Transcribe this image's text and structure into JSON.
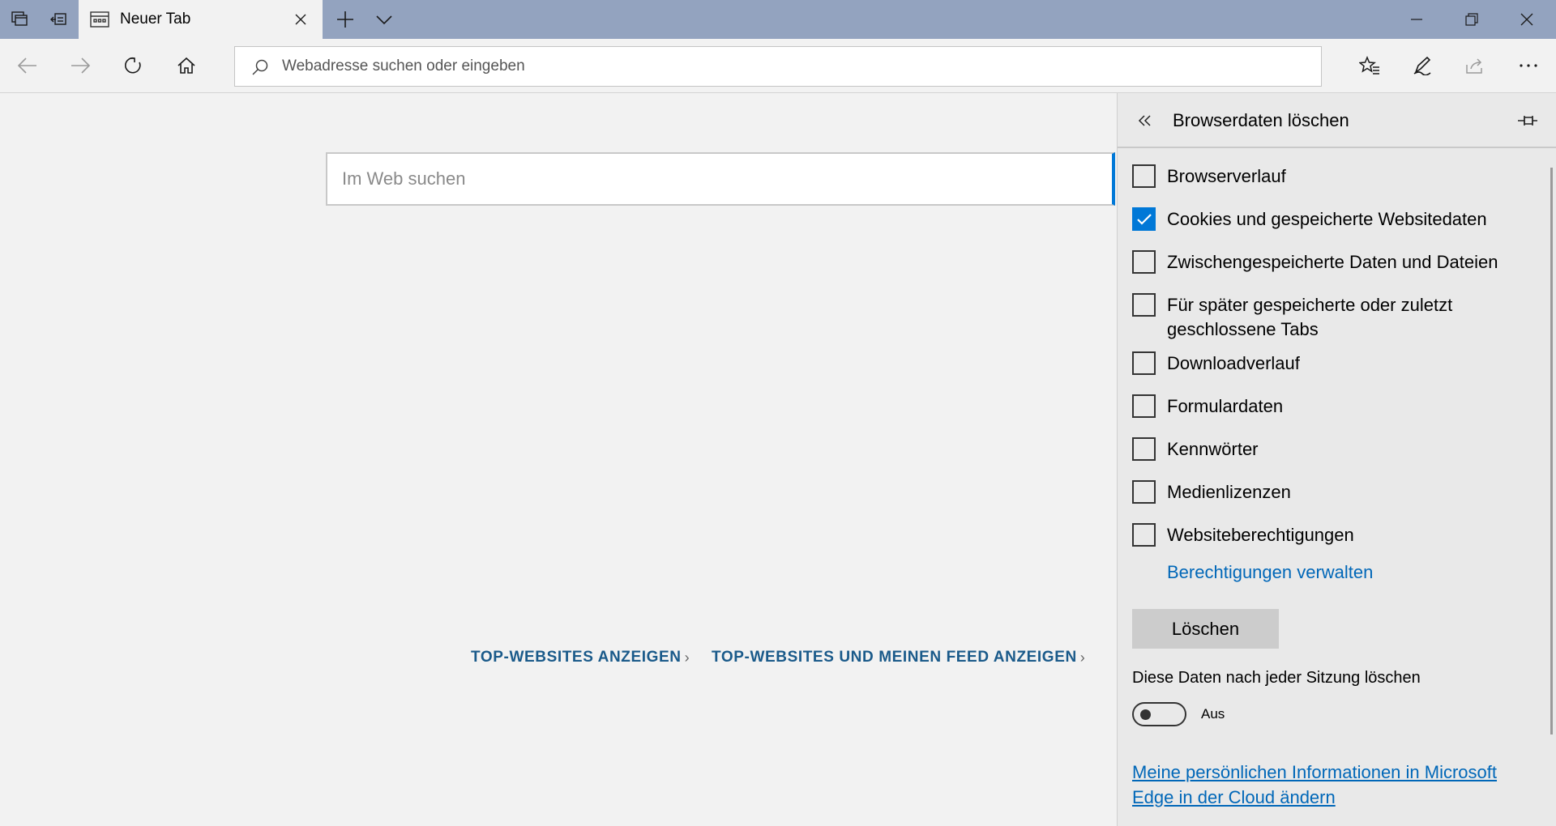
{
  "colors": {
    "titlebar": "#93a3bf",
    "accent": "#0078d7",
    "link": "#0067b8",
    "feed_link": "#1a5a8a"
  },
  "titlebar": {
    "tab_title": "Neuer Tab",
    "icons": [
      "tabs-aside-icon",
      "set-aside-tabs-icon",
      "tab-page-icon",
      "close-icon",
      "plus-icon",
      "chevron-down-icon",
      "minimize-icon",
      "restore-icon",
      "close-icon"
    ]
  },
  "toolbar": {
    "address_placeholder": "Webadresse suchen oder eingeben",
    "icons": [
      "back-arrow-icon",
      "forward-arrow-icon",
      "refresh-icon",
      "home-icon",
      "favorites-star-icon",
      "pen-icon",
      "share-icon",
      "more-icon"
    ]
  },
  "main": {
    "search_placeholder": "Im Web suchen",
    "link_top_sites": "TOP-WEBSITES ANZEIGEN",
    "link_top_sites_feed": "TOP-WEBSITES UND MEINEN FEED ANZEIGEN"
  },
  "panel": {
    "title": "Browserdaten löschen",
    "items": [
      {
        "label": "Browserverlauf",
        "checked": false
      },
      {
        "label": "Cookies und gespeicherte Websitedaten",
        "checked": true
      },
      {
        "label": "Zwischengespeicherte Daten und Dateien",
        "checked": false
      },
      {
        "label": "Für später gespeicherte oder zuletzt geschlossene Tabs",
        "checked": false
      },
      {
        "label": "Downloadverlauf",
        "checked": false
      },
      {
        "label": "Formulardaten",
        "checked": false
      },
      {
        "label": "Kennwörter",
        "checked": false
      },
      {
        "label": "Medienlizenzen",
        "checked": false
      },
      {
        "label": "Websiteberechtigungen",
        "checked": false
      }
    ],
    "manage_permissions": "Berechtigungen verwalten",
    "clear_button": "Löschen",
    "session_label": "Diese Daten nach jeder Sitzung löschen",
    "toggle_state": "Aus",
    "toggle_on": false,
    "cloud_link": "Meine persönlichen Informationen in Microsoft Edge in der Cloud ändern"
  }
}
